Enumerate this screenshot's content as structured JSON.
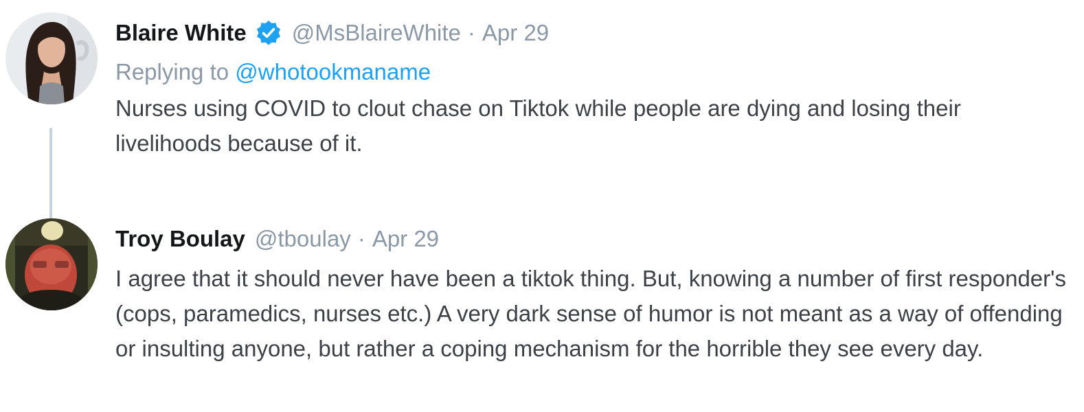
{
  "tweets": [
    {
      "display_name": "Blaire White",
      "verified": true,
      "handle": "@MsBlaireWhite",
      "separator": "·",
      "date": "Apr 29",
      "replying_to_prefix": "Replying to",
      "replying_to_handle": "@whotookmaname",
      "text": "Nurses using COVID to clout chase on Tiktok while people are dying and losing their livelihoods because of it.",
      "avatar_icon": "profile-photo-woman-long-dark-hair"
    },
    {
      "display_name": "Troy Boulay",
      "verified": false,
      "handle": "@tboulay",
      "separator": "·",
      "date": "Apr 29",
      "text": "I agree that it should never have been a tiktok thing. But, knowing a number of first responder's (cops, paramedics, nurses etc.) A very dark sense of humor is not meant as a way of offending or insulting anyone, but rather a coping mechanism for the horrible they see every day.",
      "avatar_icon": "profile-photo-man-red-face"
    }
  ],
  "colors": {
    "name": "#14171a",
    "meta": "#8b98a5",
    "link": "#1da1f2",
    "body": "#3c4147",
    "thread_line": "#c8d2da",
    "verified": "#1da1f2"
  }
}
